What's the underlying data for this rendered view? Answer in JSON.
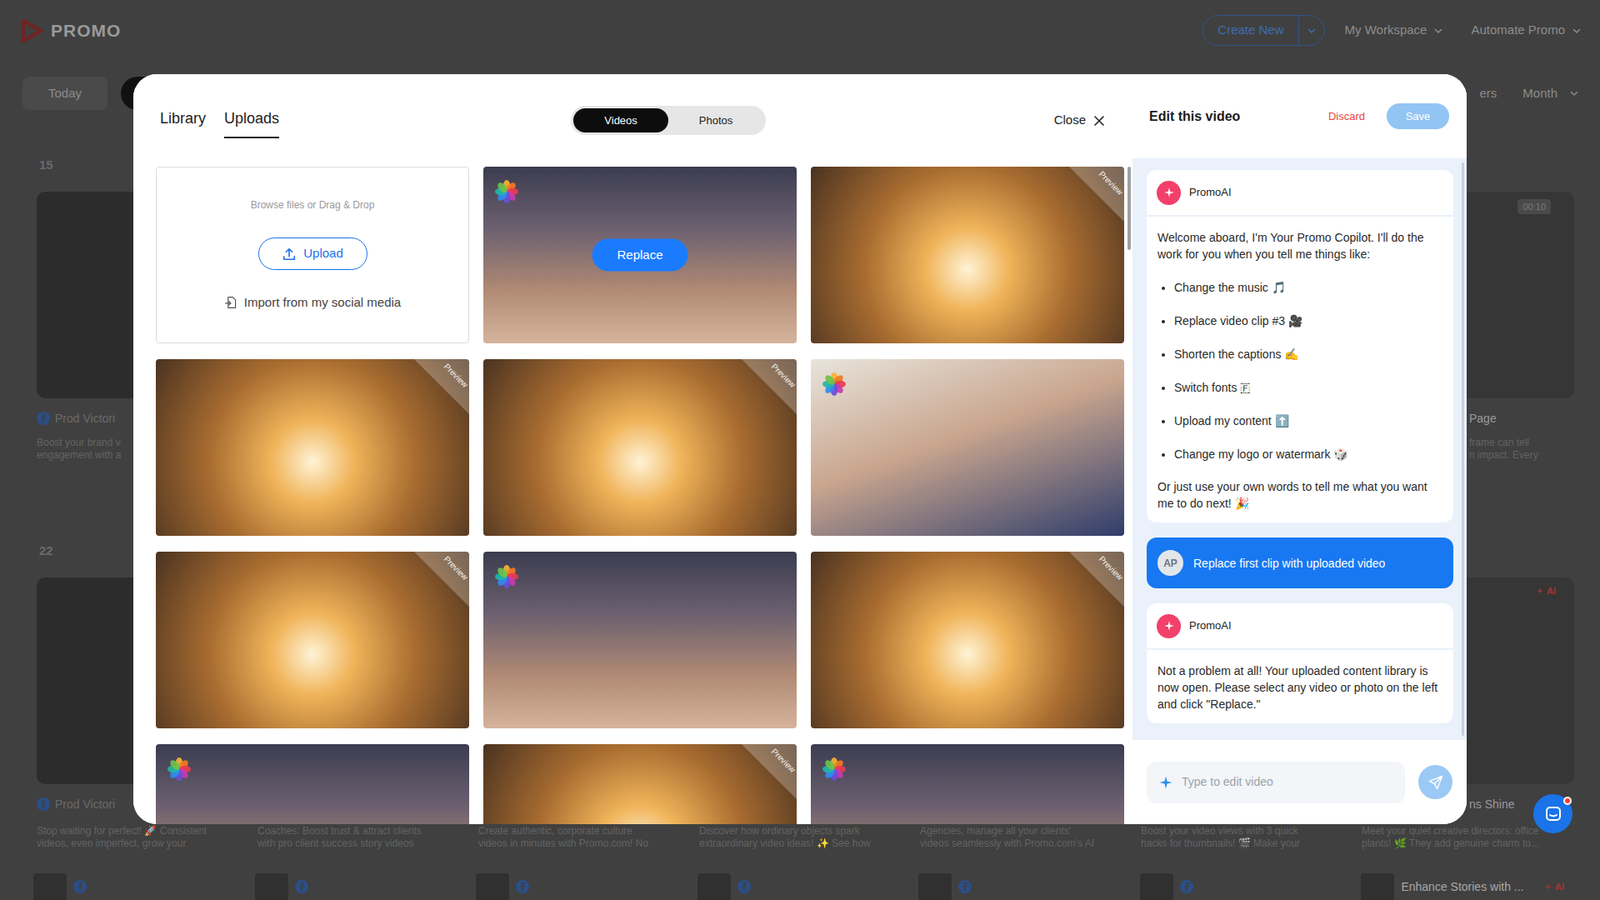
{
  "app": {
    "logo": "PROMO",
    "create_button": "Create New",
    "nav": [
      {
        "label": "My Workspace"
      },
      {
        "label": "Automate Promo"
      }
    ]
  },
  "toolbar": {
    "today": "Today",
    "filter": "ers",
    "view": "Month"
  },
  "calendar": {
    "weeks": [
      {
        "label": "15",
        "cards": [
          {
            "title": "Prod Victori",
            "description": [
              "Boost your brand v",
              "engagement with a"
            ],
            "social": true
          },
          {
            "title": "",
            "description": [],
            "social": false
          },
          {
            "title": "",
            "description": [],
            "social": false
          },
          {
            "title": "",
            "description": [],
            "social": false
          },
          {
            "title": "",
            "description": [],
            "social": false
          },
          {
            "title": "",
            "description": [],
            "social": false
          },
          {
            "title": "Page",
            "description": [
              "frame can tell",
              "n impact. Every"
            ],
            "social": false,
            "duration": "00:10"
          }
        ]
      },
      {
        "label": "22",
        "cards": [
          {
            "title": "Prod Victori",
            "description": [
              "Stop waiting for perfect! 🚀 Consistent",
              "videos, even imperfect, grow your"
            ],
            "social": true
          },
          {
            "title": "",
            "description": [
              "Coaches: Boost trust & attract clients",
              "with pro client success story videos"
            ],
            "social": false
          },
          {
            "title": "",
            "description": [
              "Create authentic, corporate culture",
              "videos in minutes with Promo.com! No"
            ],
            "social": false
          },
          {
            "title": "",
            "description": [
              "Discover how ordinary objects spark",
              "extraordinary video ideas! ✨ See how"
            ],
            "social": false
          },
          {
            "title": "",
            "description": [
              "Agencies, manage all your clients'",
              "videos seamlessly with Promo.com's AI"
            ],
            "social": false
          },
          {
            "title": "",
            "description": [
              "Boost your video views with 3 quick",
              "hacks for thumbnails! 🎬 Make your"
            ],
            "social": false
          },
          {
            "title": "ns Shine",
            "description": [
              "Meet your quiet creative directors: office",
              "plants! 🌿 They add genuine charm to..."
            ],
            "social": false,
            "ai_badge": "AI"
          }
        ]
      }
    ],
    "next_row": [
      {
        "title": "",
        "social": true
      },
      {
        "title": "",
        "social": true
      },
      {
        "title": "",
        "social": true
      },
      {
        "title": "",
        "social": true
      },
      {
        "title": "",
        "social": true
      },
      {
        "title": "",
        "social": true
      },
      {
        "title": "Enhance Stories with ...",
        "social": false,
        "ai_badge": "AI"
      }
    ]
  },
  "modal": {
    "tabs": [
      {
        "label": "Library",
        "selected": false
      },
      {
        "label": "Uploads",
        "selected": true
      }
    ],
    "media_types": [
      {
        "label": "Videos",
        "selected": true
      },
      {
        "label": "Photos",
        "selected": false
      }
    ],
    "close": "Close",
    "upload_box": {
      "hint": "Browse files or Drag & Drop",
      "button": "Upload",
      "import": "Import from my social media"
    },
    "tiles": [
      {
        "kind": "festival",
        "source_badge": true,
        "ribbon": "",
        "hovered": true,
        "action": "Replace"
      },
      {
        "kind": "sunset",
        "source_badge": false,
        "ribbon": "Preview",
        "hovered": false
      },
      {
        "kind": "sunset",
        "source_badge": false,
        "ribbon": "Preview",
        "hovered": false
      },
      {
        "kind": "sunset",
        "source_badge": false,
        "ribbon": "Preview",
        "hovered": false
      },
      {
        "kind": "child",
        "source_badge": true,
        "ribbon": "",
        "hovered": false
      },
      {
        "kind": "sunset",
        "source_badge": false,
        "ribbon": "Preview",
        "hovered": false
      },
      {
        "kind": "festival",
        "source_badge": true,
        "ribbon": "",
        "hovered": false
      },
      {
        "kind": "sunset",
        "source_badge": false,
        "ribbon": "Preview",
        "hovered": false
      },
      {
        "kind": "festival",
        "source_badge": true,
        "ribbon": "",
        "hovered": false
      },
      {
        "kind": "sunset",
        "source_badge": false,
        "ribbon": "Preview",
        "hovered": false
      },
      {
        "kind": "festival",
        "source_badge": true,
        "ribbon": "",
        "hovered": false
      }
    ],
    "editor": {
      "title": "Edit this video",
      "discard": "Discard",
      "save": {
        "label": "Save",
        "disabled": true
      },
      "messages": [
        {
          "kind": "assistant",
          "author": "PromoAI",
          "intro": "Welcome aboard, I'm Your Promo Copilot. I'll do the work for you when you tell me things like:",
          "bullets": [
            "Change the music 🎵",
            "Replace video clip #3 🎥",
            "Shorten the captions ✍️",
            "Switch fonts 🇫",
            "Upload my content ⬆️",
            "Change my logo or watermark 🎲"
          ],
          "outro": "Or just use your own words to tell me what you want me to do next! 🎉"
        },
        {
          "kind": "user",
          "initials": "AP",
          "text": "Replace first clip with uploaded video"
        },
        {
          "kind": "assistant",
          "author": "PromoAI",
          "intro": "Not a problem at all! Your uploaded content library is now open. Please select any video or photo on the left and click \"Replace.\"",
          "bullets": [],
          "outro": ""
        }
      ],
      "input": {
        "placeholder": "Type to edit video"
      }
    }
  },
  "chat_widget": {
    "unread": true
  }
}
